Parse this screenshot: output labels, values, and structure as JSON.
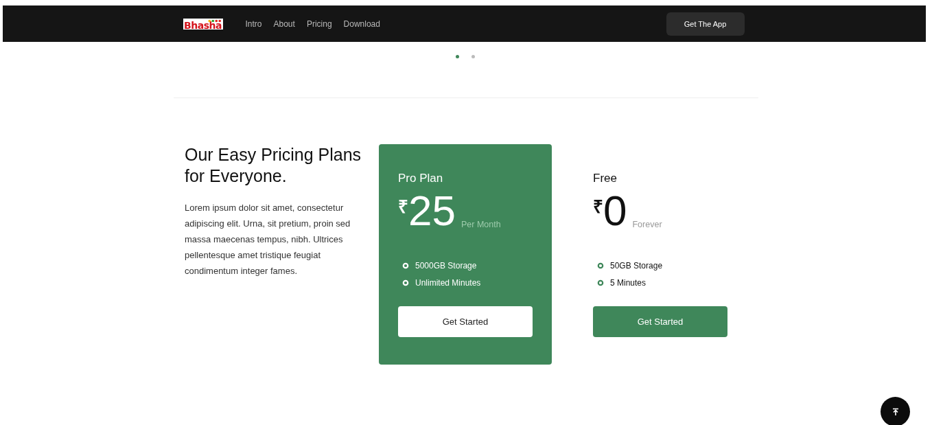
{
  "nav": {
    "logo": "Bhasha",
    "links": [
      "Intro",
      "About",
      "Pricing",
      "Download"
    ],
    "cta": "Get The App"
  },
  "carousel_dots": [
    {
      "selected": true
    },
    {
      "selected": false
    }
  ],
  "pricing": {
    "heading": "Our Easy Pricing Plans for Everyone.",
    "description": "Lorem ipsum dolor sit amet, consectetur adipiscing elit. Urna, sit pretium, proin sed massa maecenas tempus, nibh. Ultrices pellentesque amet tristique feugiat condimentum integer fames.",
    "plans": [
      {
        "name": "Pro Plan",
        "currency": "₹",
        "price": "25",
        "period": "Per Month",
        "highlighted": true,
        "features": [
          "5000GB Storage",
          "Unlimited Minutes"
        ],
        "button": "Get Started"
      },
      {
        "name": "Free",
        "currency": "₹",
        "price": "0",
        "period": "Forever",
        "highlighted": false,
        "features": [
          "50GB Storage",
          "5 Minutes"
        ],
        "button": "Get Started"
      }
    ]
  }
}
